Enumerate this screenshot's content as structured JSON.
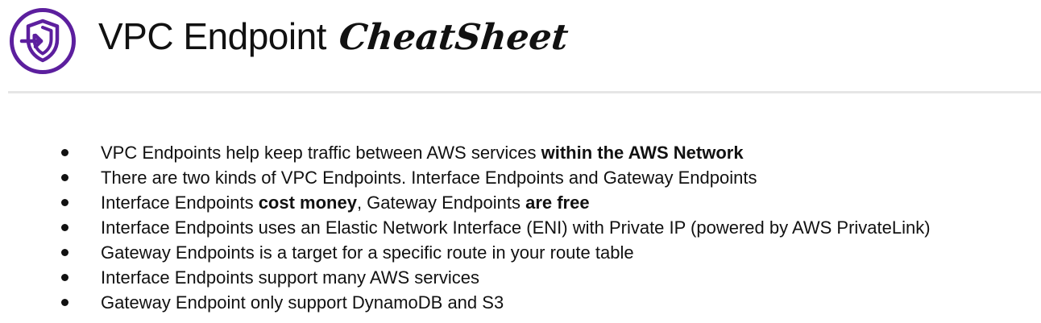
{
  "header": {
    "title_main": "VPC Endpoint",
    "title_script": "CheatSheet",
    "logo_icon": "shield-arrow-icon",
    "logo_color": "#5c1f9e"
  },
  "bullets": [
    {
      "text": "VPC Endpoints help keep traffic between AWS services ",
      "bold": "within the AWS Network",
      "tail": ""
    },
    {
      "text": "There are two kinds of VPC Endpoints. Interface Endpoints and Gateway Endpoints",
      "bold": "",
      "tail": ""
    },
    {
      "text": "Interface Endpoints ",
      "bold": "cost money",
      "tail": ", Gateway Endpoints ",
      "bold2": "are free"
    },
    {
      "text": "Interface Endpoints uses an Elastic Network Interface (ENI) with Private IP (powered by AWS PrivateLink)",
      "bold": "",
      "tail": ""
    },
    {
      "text": "Gateway Endpoints is a target for a specific route in your route table",
      "bold": "",
      "tail": ""
    },
    {
      "text": "Interface Endpoints support many AWS services",
      "bold": "",
      "tail": ""
    },
    {
      "text": "Gateway Endpoint only support DynamoDB and S3",
      "bold": "",
      "tail": ""
    }
  ]
}
